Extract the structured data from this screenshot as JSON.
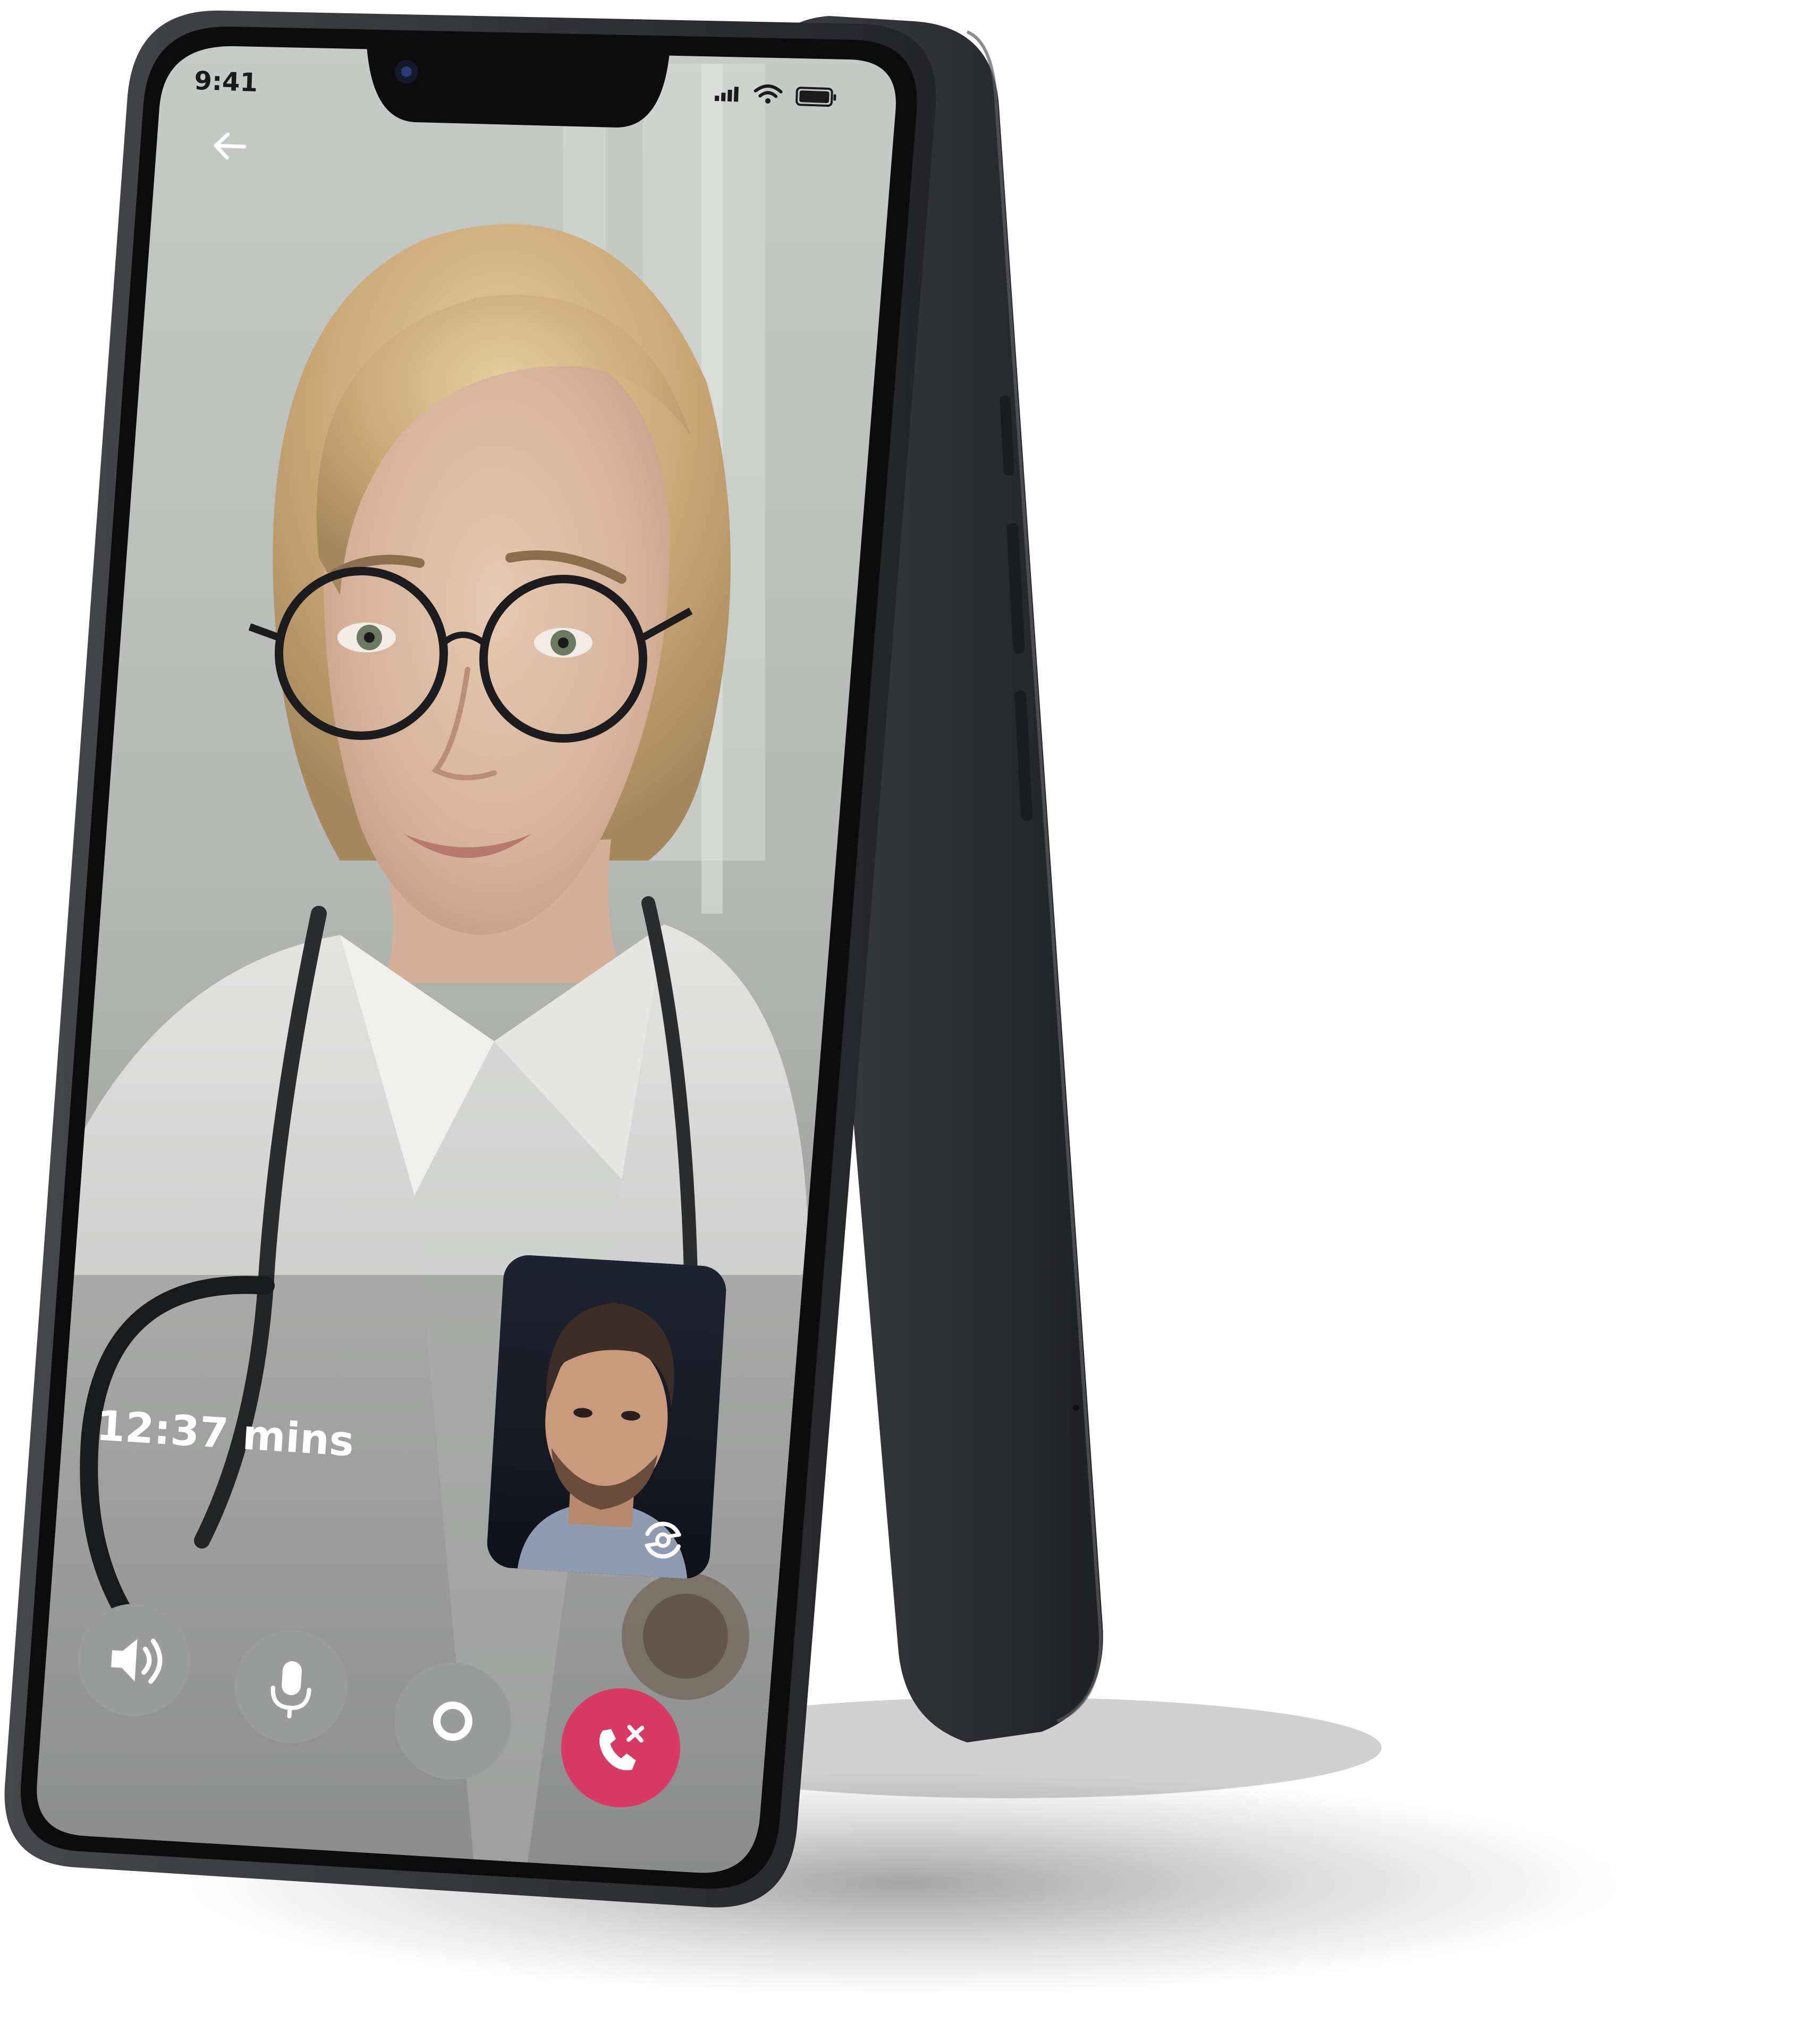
{
  "status_bar": {
    "time": "9:41",
    "signal_icon": "signal-icon",
    "wifi_icon": "wifi-icon",
    "battery_icon": "battery-icon"
  },
  "nav": {
    "back_icon": "arrow-left-icon"
  },
  "call": {
    "duration": "12:37 mins",
    "remote_participant_image": "doctor-video-feed",
    "self_view_image": "self-video-preview",
    "switch_camera_icon": "camera-switch-icon"
  },
  "controls": [
    {
      "name": "speaker-button",
      "icon": "speaker-icon"
    },
    {
      "name": "mute-button",
      "icon": "microphone-icon"
    },
    {
      "name": "record-button",
      "icon": "record-icon"
    },
    {
      "name": "end-call-button",
      "icon": "phone-hangup-icon"
    }
  ],
  "colors": {
    "device_body": "#2a2c2f",
    "device_frame": "#111213",
    "control_button_bg": "#9a9c9b",
    "end_call_bg": "#d83a63",
    "overlay_text": "#ffffff"
  }
}
